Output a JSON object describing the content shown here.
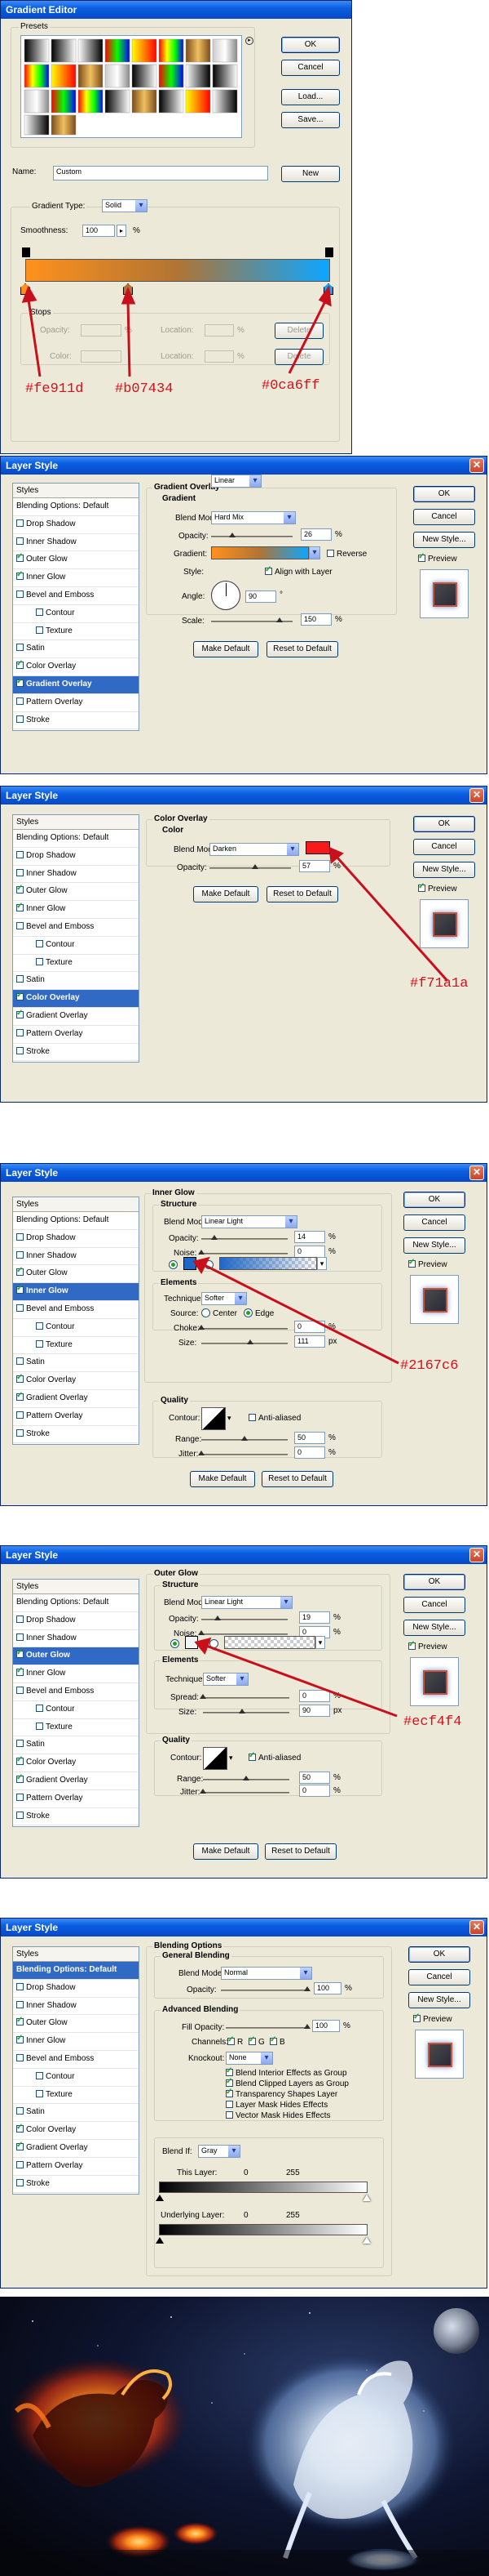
{
  "gradient_editor": {
    "title": "Gradient Editor",
    "presets_label": "Presets",
    "buttons": [
      "OK",
      "Cancel",
      "Load...",
      "Save..."
    ],
    "name_label": "Name:",
    "name_value": "Custom",
    "new_label": "New",
    "gradient_type_label": "Gradient Type:",
    "gradient_type_value": "Solid",
    "smoothness_label": "Smoothness:",
    "smoothness_value": "100",
    "smoothness_unit": "%",
    "stops_label": "Stops",
    "opacity_label": "Opacity:",
    "color_label": "Color:",
    "location_label": "Location:",
    "delete_label": "Delete",
    "pct": "%",
    "stop_colors": [
      "#fe911d",
      "#b07434",
      "#0ca6ff"
    ],
    "annotations": [
      "#fe911d",
      "#b07434",
      "#0ca6ff"
    ]
  },
  "styles_list": {
    "header": "Styles",
    "items": [
      "Blending Options: Default",
      "Drop Shadow",
      "Inner Shadow",
      "Outer Glow",
      "Inner Glow",
      "Bevel and Emboss",
      "Contour",
      "Texture",
      "Satin",
      "Color Overlay",
      "Gradient Overlay",
      "Pattern Overlay",
      "Stroke"
    ]
  },
  "common": {
    "title": "Layer Style",
    "ok": "OK",
    "cancel": "Cancel",
    "new_style": "New Style...",
    "preview": "Preview",
    "make_default": "Make Default",
    "reset_to_default": "Reset to Default",
    "pct": "%",
    "px": "px"
  },
  "gradient_overlay": {
    "section_title": "Gradient Overlay",
    "sub_title": "Gradient",
    "blend_mode_label": "Blend Mode:",
    "blend_mode_value": "Hard Mix",
    "opacity_label": "Opacity:",
    "opacity_value": "26",
    "gradient_label": "Gradient:",
    "reverse_label": "Reverse",
    "style_label": "Style:",
    "style_value": "Linear",
    "align_label": "Align with Layer",
    "angle_label": "Angle:",
    "angle_value": "90",
    "angle_unit": "°",
    "scale_label": "Scale:",
    "scale_value": "150"
  },
  "color_overlay": {
    "section_title": "Color Overlay",
    "sub_title": "Color",
    "blend_mode_label": "Blend Mode:",
    "blend_mode_value": "Darken",
    "opacity_label": "Opacity:",
    "opacity_value": "57",
    "color": "#f71a1a",
    "annotation": "#f71a1a"
  },
  "inner_glow": {
    "section_title": "Inner Glow",
    "structure_title": "Structure",
    "blend_mode_label": "Blend Mode:",
    "blend_mode_value": "Linear Light",
    "opacity_label": "Opacity:",
    "opacity_value": "14",
    "noise_label": "Noise:",
    "noise_value": "0",
    "elements_title": "Elements",
    "technique_label": "Technique:",
    "technique_value": "Softer",
    "source_label": "Source:",
    "center_label": "Center",
    "edge_label": "Edge",
    "choke_label": "Choke:",
    "choke_value": "0",
    "size_label": "Size:",
    "size_value": "111",
    "quality_title": "Quality",
    "contour_label": "Contour:",
    "anti_alias_label": "Anti-aliased",
    "range_label": "Range:",
    "range_value": "50",
    "jitter_label": "Jitter:",
    "jitter_value": "0",
    "color": "#2167c6",
    "annotation": "#2167c6"
  },
  "outer_glow": {
    "section_title": "Outer Glow",
    "structure_title": "Structure",
    "blend_mode_label": "Blend Mode:",
    "blend_mode_value": "Linear Light",
    "opacity_label": "Opacity:",
    "opacity_value": "19",
    "noise_label": "Noise:",
    "noise_value": "0",
    "elements_title": "Elements",
    "technique_label": "Technique:",
    "technique_value": "Softer",
    "spread_label": "Spread:",
    "spread_value": "0",
    "size_label": "Size:",
    "size_value": "90",
    "quality_title": "Quality",
    "contour_label": "Contour:",
    "anti_alias_label": "Anti-aliased",
    "range_label": "Range:",
    "range_value": "50",
    "jitter_label": "Jitter:",
    "jitter_value": "0",
    "color": "#ecf4f4",
    "annotation": "#ecf4f4"
  },
  "blending_options": {
    "section_title": "Blending Options",
    "general_title": "General Blending",
    "blend_mode_label": "Blend Mode:",
    "blend_mode_value": "Normal",
    "opacity_label": "Opacity:",
    "opacity_value": "100",
    "advanced_title": "Advanced Blending",
    "fill_opacity_label": "Fill Opacity:",
    "fill_opacity_value": "100",
    "channels_label": "Channels:",
    "channel_r": "R",
    "channel_g": "G",
    "channel_b": "B",
    "knockout_label": "Knockout:",
    "knockout_value": "None",
    "options": [
      "Blend Interior Effects as Group",
      "Blend Clipped Layers as Group",
      "Transparency Shapes Layer",
      "Layer Mask Hides Effects",
      "Vector Mask Hides Effects"
    ],
    "blend_if_label": "Blend If:",
    "blend_if_value": "Gray",
    "this_layer_label": "This Layer:",
    "underlying_label": "Underlying Layer:",
    "range_min": "0",
    "range_max": "255"
  }
}
